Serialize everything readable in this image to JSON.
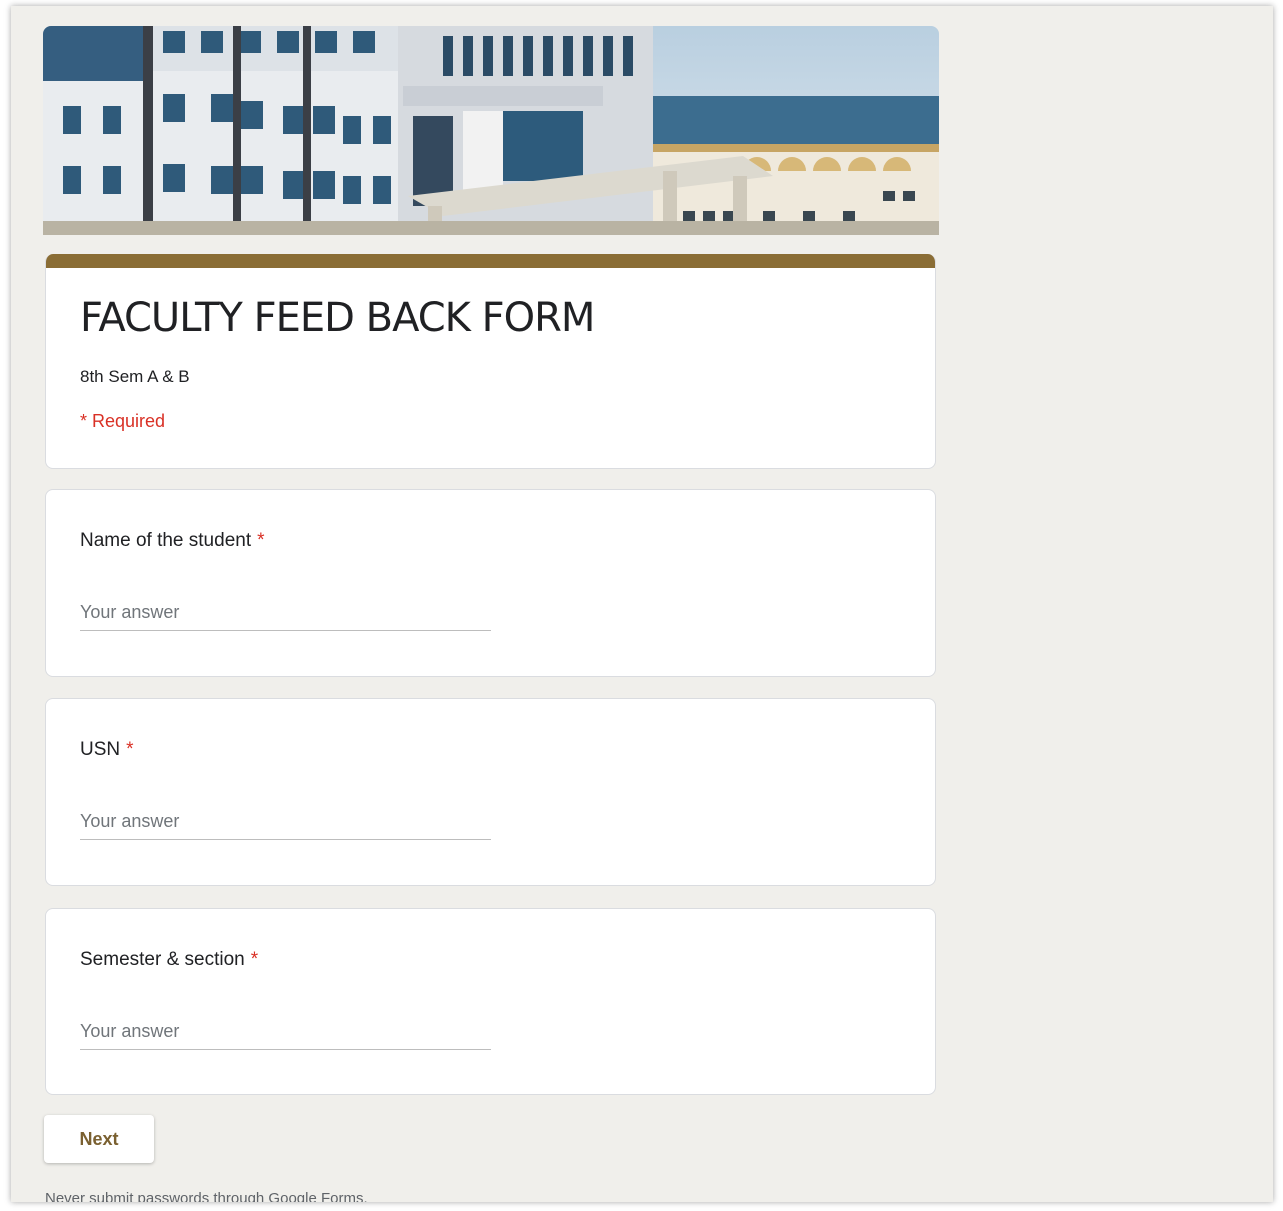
{
  "header": {
    "image_alt": "College building banner"
  },
  "form": {
    "title": "FACULTY FEED BACK FORM",
    "description": "8th Sem A & B",
    "required_note": "* Required",
    "accent_color": "#8a6d35"
  },
  "questions": [
    {
      "label": "Name of the student",
      "required_mark": "*",
      "placeholder": "Your answer"
    },
    {
      "label": "USN",
      "required_mark": "*",
      "placeholder": "Your answer"
    },
    {
      "label": "Semester & section",
      "required_mark": "*",
      "placeholder": "Your answer"
    }
  ],
  "actions": {
    "next_label": "Next"
  },
  "footer": {
    "note": "Never submit passwords through Google Forms."
  }
}
